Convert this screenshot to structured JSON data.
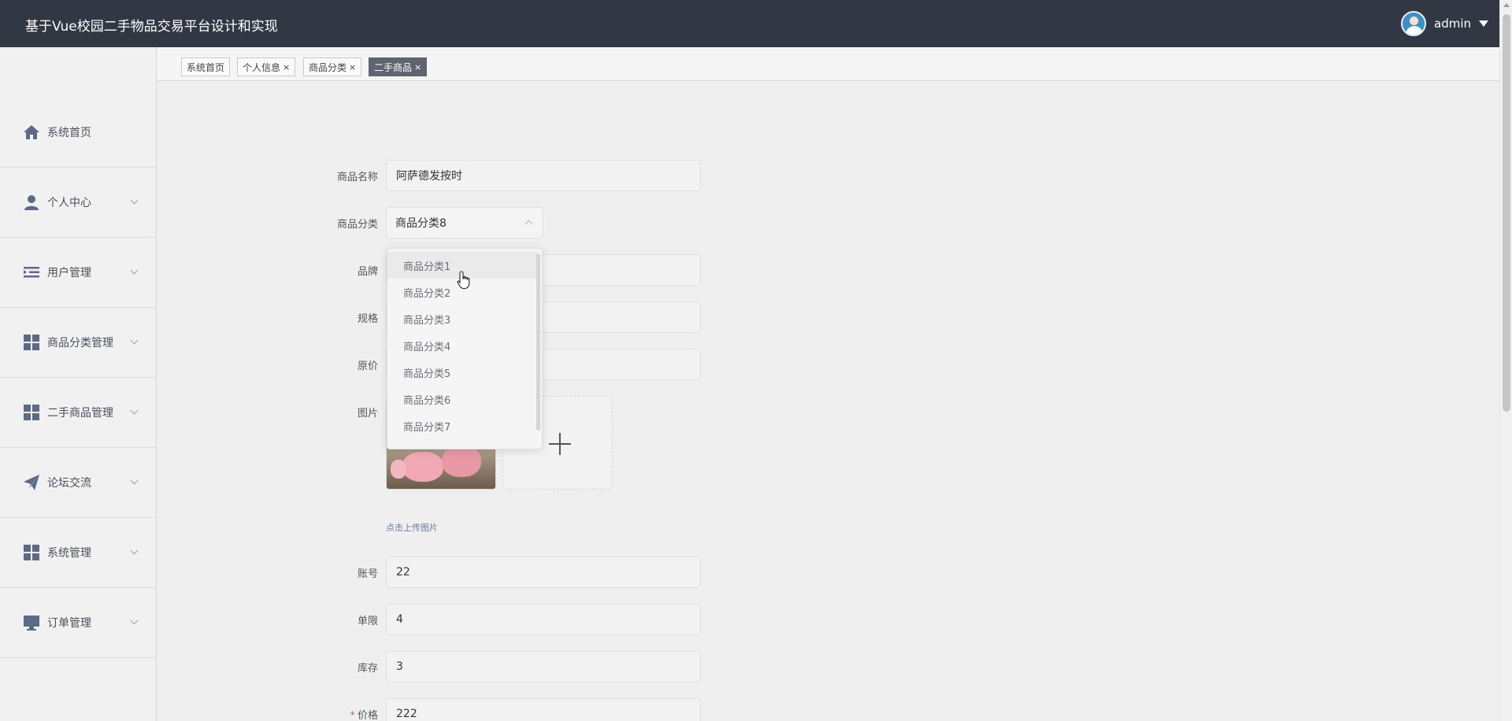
{
  "header": {
    "title": "基于Vue校园二手物品交易平台设计和实现",
    "username": "admin"
  },
  "colors": {
    "topbar": "#313843",
    "sidebar_bg": "#f1f1f1",
    "active_tab": "#5f6570",
    "required": "#e05a5a"
  },
  "sidebar": {
    "items": [
      {
        "label": "系统首页",
        "icon": "home-icon",
        "has_submenu": false
      },
      {
        "label": "个人中心",
        "icon": "user-icon",
        "has_submenu": true
      },
      {
        "label": "用户管理",
        "icon": "indent-list-icon",
        "has_submenu": true
      },
      {
        "label": "商品分类管理",
        "icon": "grid-icon",
        "has_submenu": true
      },
      {
        "label": "二手商品管理",
        "icon": "grid-icon",
        "has_submenu": true
      },
      {
        "label": "论坛交流",
        "icon": "paper-plane-icon",
        "has_submenu": true
      },
      {
        "label": "系统管理",
        "icon": "grid-icon",
        "has_submenu": true
      },
      {
        "label": "订单管理",
        "icon": "monitor-icon",
        "has_submenu": true
      }
    ]
  },
  "tabs": [
    {
      "label": "系统首页",
      "closable": false,
      "active": false
    },
    {
      "label": "个人信息",
      "closable": true,
      "active": false
    },
    {
      "label": "商品分类",
      "closable": true,
      "active": false
    },
    {
      "label": "二手商品",
      "closable": true,
      "active": true
    }
  ],
  "tab_close_glyph": "×",
  "form": {
    "name": {
      "label": "商品名称",
      "value": "阿萨德发按时"
    },
    "category": {
      "label": "商品分类",
      "value": "商品分类8"
    },
    "brand": {
      "label": "品牌"
    },
    "spec": {
      "label": "规格"
    },
    "original_price": {
      "label": "原价"
    },
    "image": {
      "label": "图片",
      "hint": "点击上传图片"
    },
    "account": {
      "label": "账号",
      "value": "22"
    },
    "limit": {
      "label": "单限",
      "value": "4"
    },
    "stock": {
      "label": "库存",
      "value": "3"
    },
    "price": {
      "label": "价格",
      "value": "222",
      "required_mark": "*"
    }
  },
  "category_dropdown": {
    "options": [
      "商品分类1",
      "商品分类2",
      "商品分类3",
      "商品分类4",
      "商品分类5",
      "商品分类6",
      "商品分类7"
    ],
    "hovered": "商品分类1"
  }
}
